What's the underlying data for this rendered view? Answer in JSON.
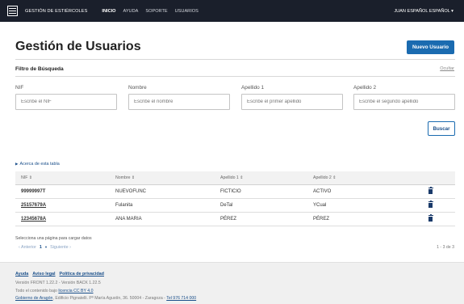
{
  "header": {
    "brand": "GESTIÓN DE ESTIÉRCOLES",
    "nav": [
      "INICIO",
      "AYUDA",
      "SOPORTE",
      "USUARIOS"
    ],
    "user": "JUAN ESPAÑOL ESPAÑOL ▾"
  },
  "page": {
    "title": "Gestión de Usuarios",
    "new_button": "Nuevo Usuario"
  },
  "filter": {
    "title": "Filtro de Búsqueda",
    "hide_link": "Ocultar",
    "fields": [
      {
        "label": "NIF",
        "placeholder": "Escribe el NIF"
      },
      {
        "label": "Nombre",
        "placeholder": "Escribe el nombre"
      },
      {
        "label": "Apellido 1",
        "placeholder": "Escribe el primer apellido"
      },
      {
        "label": "Apellido 2",
        "placeholder": "Escribe el segundo apellido"
      }
    ],
    "search_button": "Buscar"
  },
  "table": {
    "about": "Acerca de esta tabla",
    "columns": [
      "NIF ⇕",
      "Nombre ⇕",
      "Apellido 1 ⇕",
      "Apellido 2 ⇕"
    ],
    "rows": [
      {
        "nif": "99999997T",
        "nombre": "NUEVOFUNC",
        "apellido1": "FICTICIO",
        "apellido2": "ACTIVO"
      },
      {
        "nif": "25157679A",
        "nombre": "Fulanita",
        "apellido1": "DeTal",
        "apellido2": "YCual"
      },
      {
        "nif": "12345678A",
        "nombre": "ANA MARIA",
        "apellido1": "PÉREZ",
        "apellido2": "PÉREZ"
      }
    ],
    "select_note": "Selecciona una página para cargar datos",
    "pager": {
      "prev": "‹ Anterior",
      "current": "1",
      "caret": "▾",
      "next": "Siguiente ›"
    },
    "range": "1 - 3 de 3"
  },
  "footer": {
    "links": [
      "Ayuda",
      "Aviso legal",
      "Política de privacidad"
    ],
    "version": "Versión FRONT 1.22.2 - Versión BACK 1.22.5",
    "license_prefix": "Todo el contenido bajo ",
    "license_link": "licencia CC BY 4.0",
    "address_link1": "Gobierno de Aragón",
    "address_text": ", Edificio Pignatelli. Pº María Agustín, 36. 50004 - Zaragoza - ",
    "address_link2": "Tel 976 714 000"
  },
  "colors": {
    "nav_bg": "#1a1f2b",
    "primary": "#1a6bb0",
    "link": "#1a4f8a"
  }
}
